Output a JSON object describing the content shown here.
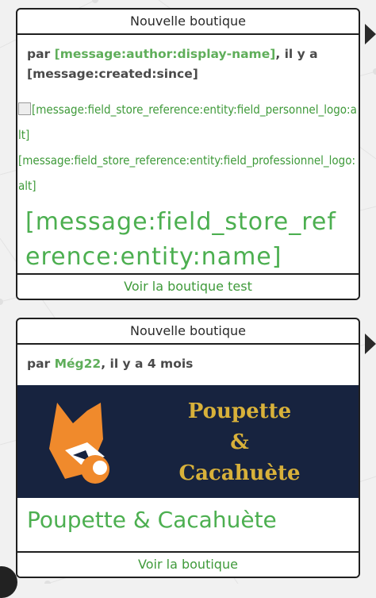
{
  "cards": [
    {
      "header": "Nouvelle boutique",
      "meta_prefix": "par ",
      "author": "[message:author:display-name]",
      "meta_suffix": ", il y a [message:created:since]",
      "logo_alt_1": "[message:field_store_reference:entity:field_personnel_logo:alt]",
      "logo_alt_2": "[message:field_store_reference:entity:field_professionnel_logo:alt]",
      "store_name": "[message:field_store_reference:entity:name]",
      "footer_link": "Voir la boutique test"
    },
    {
      "header": "Nouvelle boutique",
      "meta_prefix": "par ",
      "author": "Még22",
      "meta_suffix": ", il y a 4 mois",
      "banner_line1": "Poupette",
      "banner_line2": "&",
      "banner_line3": "Cacahuète",
      "store_name": "Poupette & Cacahuète",
      "footer_link": "Voir la boutique"
    }
  ],
  "colors": {
    "link_green": "#4caf50",
    "banner_bg": "#17233f",
    "banner_text": "#d8b13a",
    "fox_orange": "#f08a2c"
  }
}
